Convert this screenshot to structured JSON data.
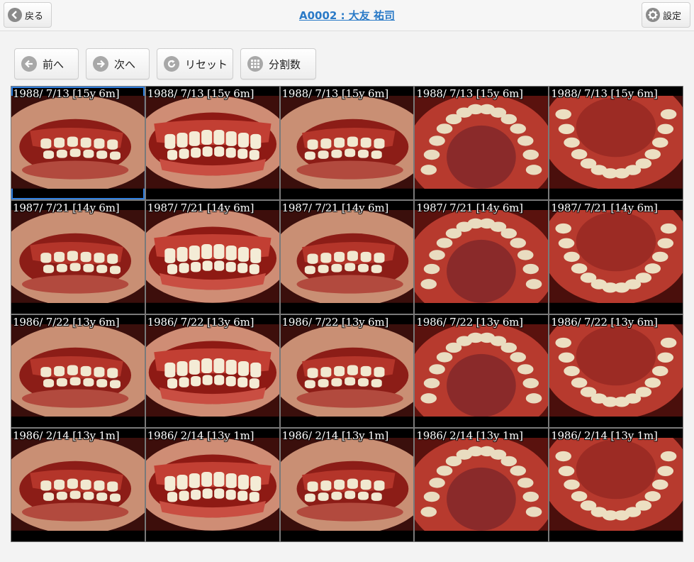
{
  "header": {
    "back_label": "戻る",
    "title": "A0002 : 大友 祐司",
    "settings_label": "設定"
  },
  "toolbar": {
    "prev_label": "前へ",
    "next_label": "次へ",
    "reset_label": "リセット",
    "split_label": "分割数"
  },
  "colors": {
    "title_link": "#2a7ac7",
    "selection": "#2f7fe0",
    "grid_border": "#7a7a7a"
  },
  "grid": {
    "selected_index": 0,
    "cells": [
      {
        "caption": "1988/ 7/13 [15y 6m]",
        "view": "right-lateral"
      },
      {
        "caption": "1988/ 7/13 [15y 6m]",
        "view": "frontal"
      },
      {
        "caption": "1988/ 7/13 [15y 6m]",
        "view": "left-lateral"
      },
      {
        "caption": "1988/ 7/13 [15y 6m]",
        "view": "upper-occlusal"
      },
      {
        "caption": "1988/ 7/13 [15y 6m]",
        "view": "lower-occlusal"
      },
      {
        "caption": "1987/ 7/21 [14y 6m]",
        "view": "right-lateral"
      },
      {
        "caption": "1987/ 7/21 [14y 6m]",
        "view": "frontal"
      },
      {
        "caption": "1987/ 7/21 [14y 6m]",
        "view": "left-lateral"
      },
      {
        "caption": "1987/ 7/21 [14y 6m]",
        "view": "upper-occlusal"
      },
      {
        "caption": "1987/ 7/21 [14y 6m]",
        "view": "lower-occlusal"
      },
      {
        "caption": "1986/ 7/22 [13y 6m]",
        "view": "right-lateral"
      },
      {
        "caption": "1986/ 7/22 [13y 6m]",
        "view": "frontal"
      },
      {
        "caption": "1986/ 7/22 [13y 6m]",
        "view": "left-lateral"
      },
      {
        "caption": "1986/ 7/22 [13y 6m]",
        "view": "upper-occlusal"
      },
      {
        "caption": "1986/ 7/22 [13y 6m]",
        "view": "lower-occlusal"
      },
      {
        "caption": "1986/ 2/14 [13y 1m]",
        "view": "right-lateral"
      },
      {
        "caption": "1986/ 2/14 [13y 1m]",
        "view": "frontal"
      },
      {
        "caption": "1986/ 2/14 [13y 1m]",
        "view": "left-lateral"
      },
      {
        "caption": "1986/ 2/14 [13y 1m]",
        "view": "upper-occlusal"
      },
      {
        "caption": "1986/ 2/14 [13y 1m]",
        "view": "lower-occlusal"
      }
    ]
  }
}
